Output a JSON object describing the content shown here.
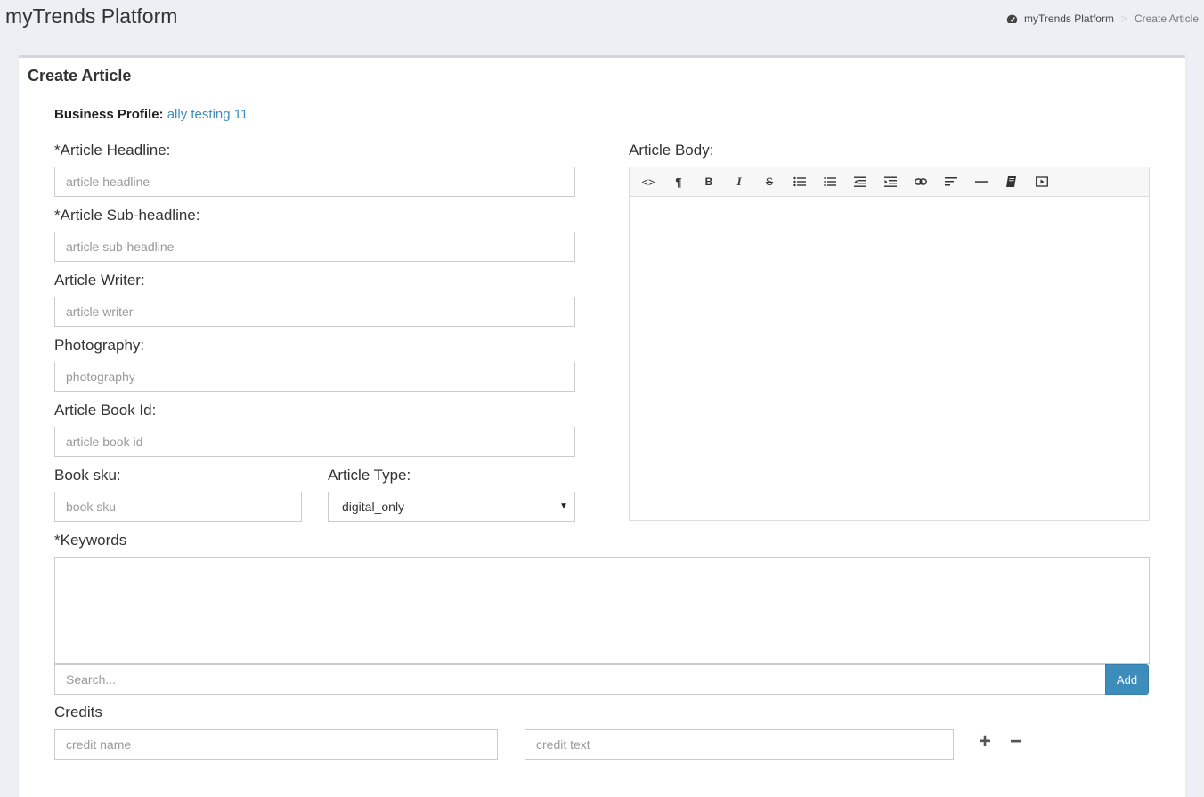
{
  "header": {
    "app_title": "myTrends Platform",
    "breadcrumb": {
      "home": "myTrends Platform",
      "separator": ">",
      "current": "Create Article"
    }
  },
  "box": {
    "title": "Create Article"
  },
  "business_profile": {
    "label": "Business Profile:",
    "value": "ally testing 11"
  },
  "fields": {
    "headline": {
      "label": "*Article Headline:",
      "placeholder": "article headline"
    },
    "subheadline": {
      "label": "*Article Sub-headline:",
      "placeholder": "article sub-headline"
    },
    "writer": {
      "label": "Article Writer:",
      "placeholder": "article writer"
    },
    "photography": {
      "label": "Photography:",
      "placeholder": "photography"
    },
    "book_id": {
      "label": "Article Book Id:",
      "placeholder": "article book id"
    },
    "book_sku": {
      "label": "Book sku:",
      "placeholder": "book sku"
    },
    "article_type": {
      "label": "Article Type:",
      "value": "digital_only"
    }
  },
  "body": {
    "label": "Article Body:",
    "toolbar": [
      "code-view-icon",
      "paragraph-icon",
      "bold-icon",
      "italic-icon",
      "strikethrough-icon",
      "unordered-list-icon",
      "ordered-list-icon",
      "outdent-icon",
      "indent-icon",
      "link-icon",
      "align-icon",
      "horizontal-rule-icon",
      "book-icon",
      "video-icon"
    ],
    "toolbar_text": {
      "code": "<>",
      "paragraph": "¶",
      "bold": "B",
      "italic": "I",
      "strike": "S"
    }
  },
  "keywords": {
    "label": "*Keywords",
    "search_placeholder": "Search...",
    "add_label": "Add"
  },
  "credits": {
    "label": "Credits",
    "name_placeholder": "credit name",
    "text_placeholder": "credit text",
    "add_symbol": "+",
    "remove_symbol": "−"
  },
  "colors": {
    "accent": "#3c8dbc",
    "background": "#ecf0f5"
  }
}
